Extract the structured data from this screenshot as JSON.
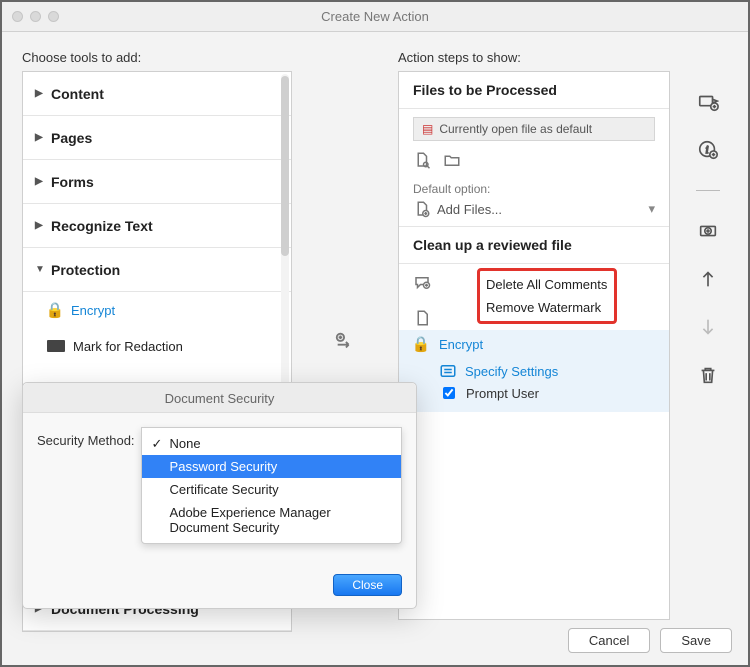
{
  "window": {
    "title": "Create New Action"
  },
  "left": {
    "label": "Choose tools to add:",
    "groups": [
      {
        "label": "Content",
        "open": false
      },
      {
        "label": "Pages",
        "open": false
      },
      {
        "label": "Forms",
        "open": false
      },
      {
        "label": "Recognize Text",
        "open": false
      },
      {
        "label": "Protection",
        "open": true
      }
    ],
    "protection_tools": [
      {
        "label": "Encrypt",
        "icon": "lock-icon",
        "active": true
      },
      {
        "label": "Mark for Redaction",
        "icon": "redact-icon",
        "active": false
      }
    ],
    "below_popover_group": "Document Processing"
  },
  "popover": {
    "title": "Document Security",
    "select_label": "Security Method:",
    "options": [
      {
        "label": "None",
        "checked": true
      },
      {
        "label": "Password Security",
        "selected": true
      },
      {
        "label": "Certificate Security"
      },
      {
        "label": "Adobe Experience Manager Document Security"
      }
    ],
    "close": "Close"
  },
  "right": {
    "label": "Action steps to show:",
    "files_header": "Files to be Processed",
    "default_file": "Currently open file as default",
    "default_option_label": "Default option:",
    "add_files": "Add Files...",
    "cleanup_header": "Clean up a reviewed file",
    "steps": {
      "delete_comments": "Delete All Comments",
      "remove_watermark": "Remove Watermark",
      "encrypt": "Encrypt",
      "specify_settings": "Specify Settings",
      "prompt_user": "Prompt User"
    }
  },
  "footer": {
    "cancel": "Cancel",
    "save": "Save"
  }
}
